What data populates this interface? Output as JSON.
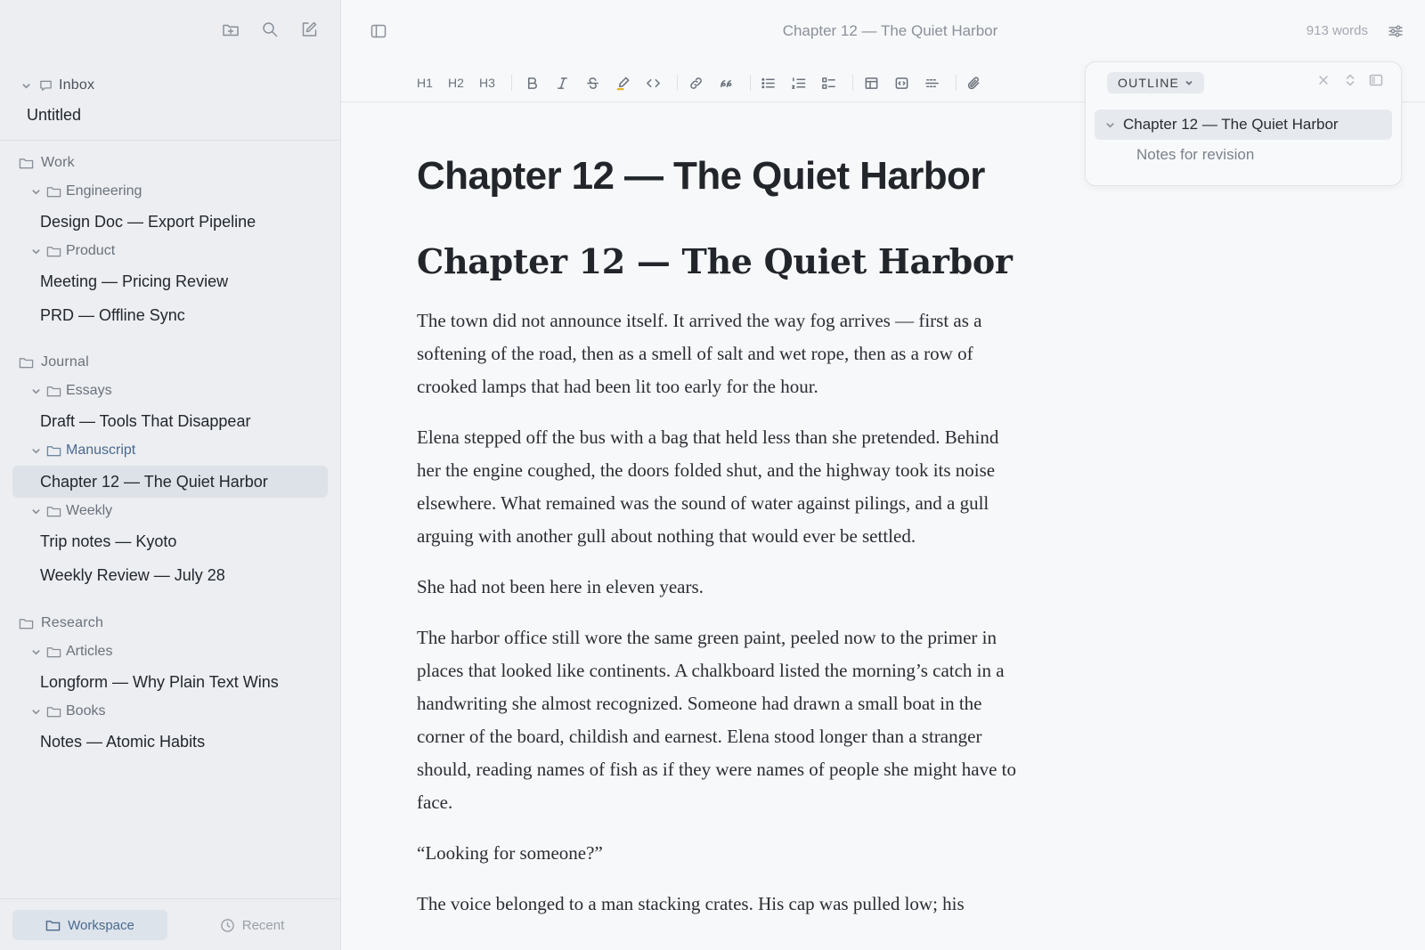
{
  "sidebar": {
    "inbox": {
      "label": "Inbox",
      "items": [
        "Untitled"
      ]
    },
    "groups": [
      {
        "label": "Work",
        "folders": [
          {
            "label": "Engineering",
            "docs": [
              "Design Doc — Export Pipeline"
            ]
          },
          {
            "label": "Product",
            "docs": [
              "Meeting — Pricing Review",
              "PRD — Offline Sync"
            ]
          }
        ]
      },
      {
        "label": "Journal",
        "folders": [
          {
            "label": "Essays",
            "docs": [
              "Draft — Tools That Disappear"
            ]
          },
          {
            "label": "Manuscript",
            "docs": [
              "Chapter 12 — The Quiet Harbor"
            ]
          },
          {
            "label": "Weekly",
            "docs": [
              "Trip notes — Kyoto",
              "Weekly Review — July 28"
            ]
          }
        ]
      },
      {
        "label": "Research",
        "folders": [
          {
            "label": "Articles",
            "docs": [
              "Longform — Why Plain Text Wins"
            ]
          },
          {
            "label": "Books",
            "docs": [
              "Notes — Atomic Habits"
            ]
          }
        ]
      }
    ],
    "footer": {
      "workspace": "Workspace",
      "recent": "Recent"
    }
  },
  "topbar": {
    "title": "Chapter 12 — The Quiet Harbor",
    "word_count": "913 words"
  },
  "toolbar": {
    "h1": "H1",
    "h2": "H2",
    "h3": "H3"
  },
  "editor": {
    "title": "Chapter 12 — The Quiet Harbor",
    "heading": "Chapter 12 — The Quiet Harbor",
    "paragraphs": [
      "The town did not announce itself. It arrived the way fog arrives — first as a softening of the road, then as a smell of salt and wet rope, then as a row of crooked lamps that had been lit too early for the hour.",
      "Elena stepped off the bus with a bag that held less than she pretended. Behind her the engine coughed, the doors folded shut, and the highway took its noise elsewhere. What remained was the sound of water against pilings, and a gull arguing with another gull about nothing that would ever be settled.",
      "She had not been here in eleven years.",
      "The harbor office still wore the same green paint, peeled now to the primer in places that looked like continents. A chalkboard listed the morning’s catch in a handwriting she almost recognized. Someone had drawn a small boat in the corner of the board, childish and earnest. Elena stood longer than a stranger should, reading names of fish as if they were names of people she might have to face.",
      "“Looking for someone?”",
      "The voice belonged to a man stacking crates. His cap was pulled low; his"
    ]
  },
  "outline": {
    "label": "OUTLINE",
    "items": [
      "Chapter 12 — The Quiet Harbor",
      "Notes for revision"
    ]
  },
  "colors": {
    "accent": "#4a6a8f",
    "active_row": "#dde2e8",
    "sidebar_bg": "#eceef1"
  }
}
